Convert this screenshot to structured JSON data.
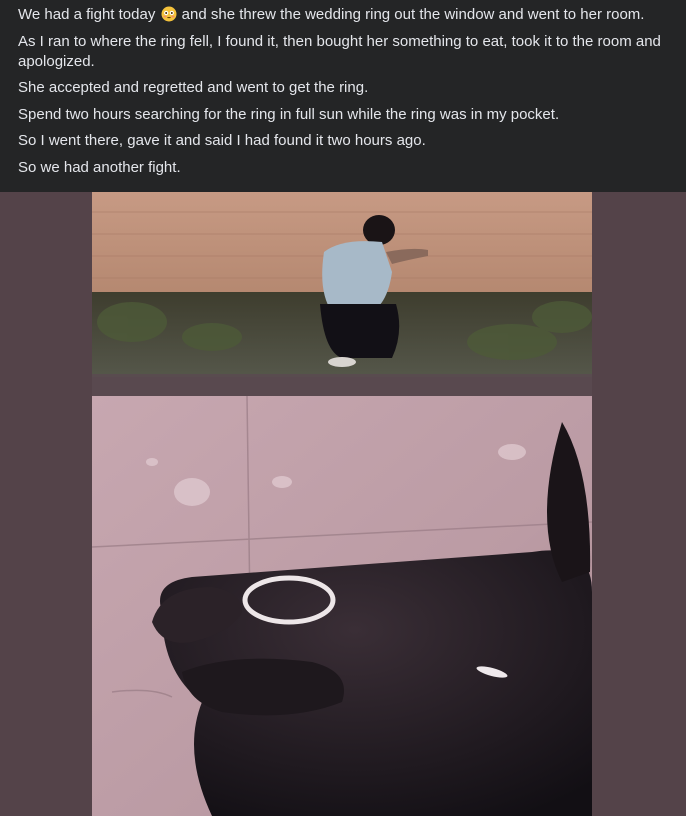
{
  "post": {
    "lines": [
      {
        "before_emoji": "We had a fight today",
        "emoji": "flushed-face-emoji",
        "after_emoji": "and she threw the wedding ring out the window and went to her room."
      },
      {
        "text": "As I ran to where the ring fell, I found it, then bought her something to eat, took it to the room and apologized."
      },
      {
        "text": "She accepted and regretted and went to get the ring."
      },
      {
        "text": "Spend two hours searching for the ring in full sun while the ring was in my pocket."
      },
      {
        "text": "So I went there, gave it and said I had found it two hours ago."
      },
      {
        "text": "So we had another fight."
      }
    ]
  },
  "colors": {
    "background": "#242526",
    "text": "#e4e6eb",
    "letterbox": "#544349"
  },
  "media": {
    "photo_icon": "ring-photo"
  }
}
